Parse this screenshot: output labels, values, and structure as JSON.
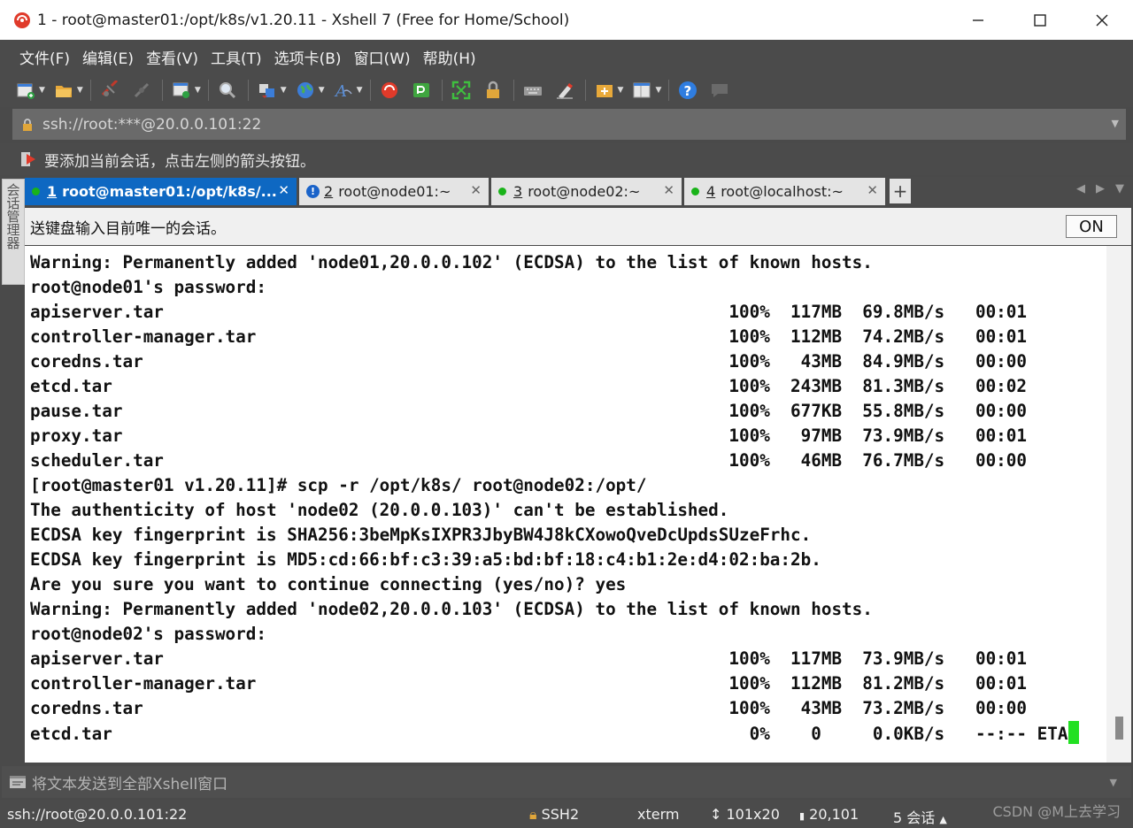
{
  "window": {
    "title": "1 - root@master01:/opt/k8s/v1.20.11 - Xshell 7 (Free for Home/School)",
    "app_icon": "xshell-logo-icon",
    "controls": [
      "minimize-icon",
      "maximize-icon",
      "close-icon"
    ]
  },
  "menu": {
    "items": [
      "文件(F)",
      "编辑(E)",
      "查看(V)",
      "工具(T)",
      "选项卡(B)",
      "窗口(W)",
      "帮助(H)"
    ]
  },
  "toolbar": {
    "icons": [
      "new-session-icon",
      "open-folder-icon",
      "disconnect-icon",
      "reconnect-icon",
      "new-window-icon",
      "find-icon",
      "transfer-icon",
      "globe-icon",
      "font-icon",
      "xftp-icon",
      "xagent-icon",
      "fullscreen-icon",
      "lock-icon",
      "keyboard-icon",
      "highlight-icon",
      "add-tab-icon",
      "layout-icon",
      "help-icon",
      "chat-icon"
    ]
  },
  "address": {
    "value": "ssh://root:***@20.0.0.101:22"
  },
  "hint": {
    "text": "要添加当前会话，点击左侧的箭头按钮。"
  },
  "side_panel": {
    "label": "会话管理器"
  },
  "tabs": [
    {
      "num": "1",
      "label": "root@master01:/opt/k8s/...",
      "status": "connected",
      "active": true
    },
    {
      "num": "2",
      "label": "root@node01:~",
      "status": "warning",
      "active": false
    },
    {
      "num": "3",
      "label": "root@node02:~",
      "status": "connected",
      "active": false
    },
    {
      "num": "4",
      "label": "root@localhost:~",
      "status": "connected",
      "active": false
    }
  ],
  "sendbar": {
    "text": "送键盘输入目前唯一的会话。",
    "toggle": "ON"
  },
  "terminal": {
    "lines": [
      "Warning: Permanently added 'node01,20.0.0.102' (ECDSA) to the list of known hosts.",
      "root@node01's password:",
      "apiserver.tar                                                       100%  117MB  69.8MB/s   00:01",
      "controller-manager.tar                                              100%  112MB  74.2MB/s   00:01",
      "coredns.tar                                                         100%   43MB  84.9MB/s   00:00",
      "etcd.tar                                                            100%  243MB  81.3MB/s   00:02",
      "pause.tar                                                           100%  677KB  55.8MB/s   00:00",
      "proxy.tar                                                           100%   97MB  73.9MB/s   00:01",
      "scheduler.tar                                                       100%   46MB  76.7MB/s   00:00",
      "[root@master01 v1.20.11]# scp -r /opt/k8s/ root@node02:/opt/",
      "The authenticity of host 'node02 (20.0.0.103)' can't be established.",
      "ECDSA key fingerprint is SHA256:3beMpKsIXPR3JbyBW4J8kCXowoQveDcUpdsSUzeFrhc.",
      "ECDSA key fingerprint is MD5:cd:66:bf:c3:39:a5:bd:bf:18:c4:b1:2e:d4:02:ba:2b.",
      "Are you sure you want to continue connecting (yes/no)? yes",
      "Warning: Permanently added 'node02,20.0.0.103' (ECDSA) to the list of known hosts.",
      "root@node02's password:",
      "apiserver.tar                                                       100%  117MB  73.9MB/s   00:01",
      "controller-manager.tar                                              100%  112MB  81.2MB/s   00:01",
      "coredns.tar                                                         100%   43MB  73.2MB/s   00:00",
      "etcd.tar                                                              0%    0     0.0KB/s   --:-- ETA"
    ]
  },
  "compose": {
    "placeholder": "将文本发送到全部Xshell窗口"
  },
  "status": {
    "connection": "ssh://root@20.0.0.101:22",
    "protocol": "SSH2",
    "terminal": "xterm",
    "size": "101x20",
    "cursor": "20,101",
    "sessions": "5 会话"
  },
  "watermark": "CSDN @M上去学习",
  "colors": {
    "tab_active": "#0e68c2",
    "cursor": "#22e022",
    "chrome": "#4b4b4b"
  }
}
